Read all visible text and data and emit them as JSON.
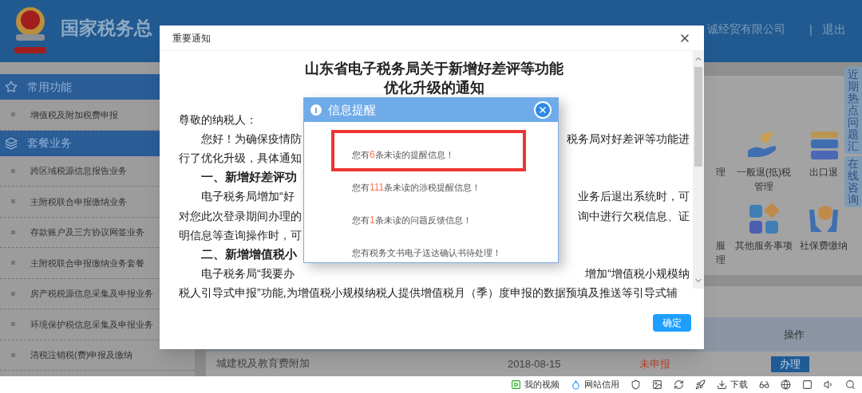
{
  "header": {
    "title": "国家税务总",
    "company": "诚经贸有限公司",
    "separator": "|",
    "logout": "退出"
  },
  "side_tabs": [
    "近期热点问题汇",
    "在线咨询"
  ],
  "sidebar": [
    {
      "kind": "section",
      "label": "常用功能"
    },
    {
      "kind": "item",
      "label": "增值税及附加税费申报"
    },
    {
      "kind": "section",
      "label": "套餐业务"
    },
    {
      "kind": "item",
      "label": "跨区域税源信息报告业务"
    },
    {
      "kind": "item",
      "label": "主附税联合申报缴纳业务"
    },
    {
      "kind": "item",
      "label": "存款账户及三方协议网签业务"
    },
    {
      "kind": "item",
      "label": "主附税联合申报缴纳业务套餐"
    },
    {
      "kind": "item",
      "label": "房产税税源信息采集及申报业务"
    },
    {
      "kind": "item",
      "label": "环境保护税信息采集及申报业务"
    },
    {
      "kind": "item",
      "label": "清税注销税(费)申报及缴纳"
    }
  ],
  "services": [
    {
      "label": "理"
    },
    {
      "label": "一般退(抵)税管理"
    },
    {
      "label": "出口退"
    },
    {
      "label": "服理"
    },
    {
      "label": "其他服务事项"
    },
    {
      "label": "社保费缴纳"
    }
  ],
  "table": {
    "column_header": "操作",
    "rows": [
      {
        "name": "城建税及教育费附加",
        "date": "2018-08-15",
        "status": "未申报",
        "action": "办理"
      }
    ]
  },
  "notice": {
    "title": "重要通知",
    "heading": [
      "山东省电子税务局关于新增好差评等功能",
      "优化升级的通知"
    ],
    "lines": [
      {
        "kind": "plain",
        "left": "尊敬的纳税人："
      },
      {
        "kind": "indent",
        "left": "您好！为确保疫情防",
        "right": "税务局对好差评等功能进"
      },
      {
        "kind": "plain",
        "left": "行了优化升级，具体通知"
      },
      {
        "kind": "heading",
        "left": "一、新增好差评功"
      },
      {
        "kind": "indent",
        "left": "电子税务局增加“好",
        "right": "业务后退出系统时，可"
      },
      {
        "kind": "plain",
        "left": "对您此次登录期间办理的",
        "right": "询中进行欠税信息、证"
      },
      {
        "kind": "plain",
        "left": "明信息等查询操作时，可"
      },
      {
        "kind": "heading",
        "left": "二、新增增值税小"
      },
      {
        "kind": "indent",
        "left": "电子税务局“我要办",
        "right": "增加“增值税小规模纳"
      },
      {
        "kind": "plain",
        "left": "税人引导式申报”功能,为增值税小规模纳税人提供增值税月（季）度申报的数据预填及推送等引导式辅"
      }
    ],
    "confirm": "确定"
  },
  "alert": {
    "title": "信息提醒",
    "messages": [
      {
        "prefix": "您有",
        "count": "6",
        "suffix": "条未读的提醒信息！",
        "highlighted": true
      },
      {
        "prefix": "您有",
        "count": "111",
        "suffix": "条未读的涉税提醒信息！",
        "highlighted": false
      },
      {
        "prefix": "您有",
        "count": "1",
        "suffix": "条未读的问题反馈信息！",
        "highlighted": false
      },
      {
        "prefix": "您有税务文书电子送达确认书待处理！",
        "highlighted": false
      }
    ]
  },
  "status_bar": [
    {
      "label": "我的视频"
    },
    {
      "label": "网站信用"
    },
    {
      "kind": "icon"
    },
    {
      "kind": "icon"
    },
    {
      "kind": "icon"
    },
    {
      "kind": "icon"
    },
    {
      "label": "下载"
    },
    {
      "kind": "icon"
    },
    {
      "kind": "icon"
    },
    {
      "kind": "icon"
    },
    {
      "kind": "icon"
    },
    {
      "kind": "icon"
    }
  ]
}
